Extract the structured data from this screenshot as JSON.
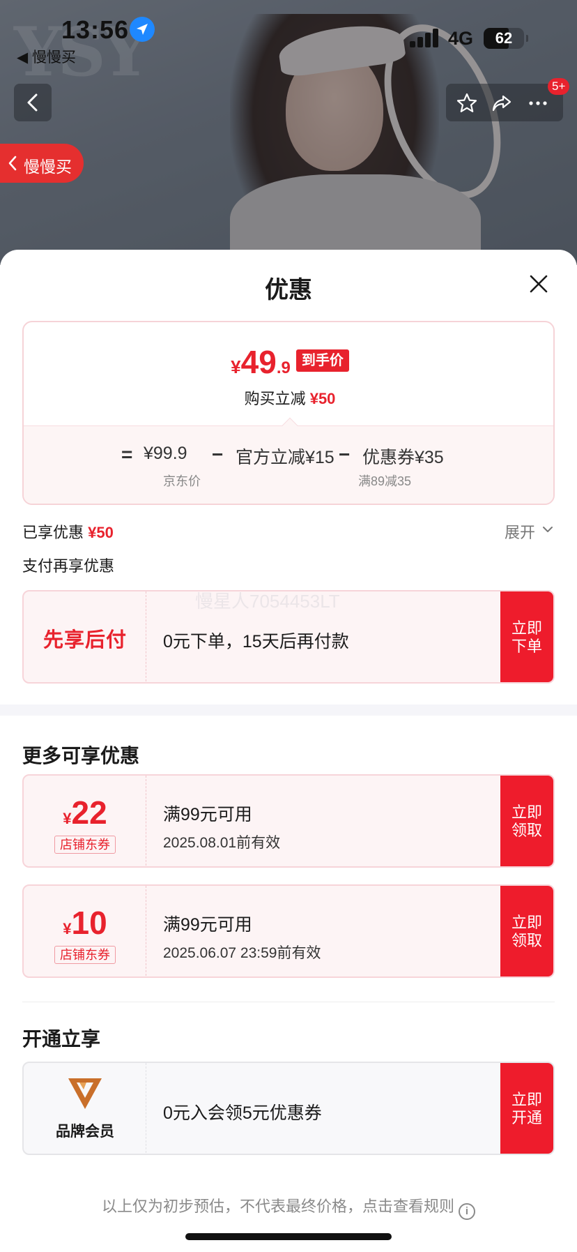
{
  "status_bar": {
    "time": "13:56",
    "back_app": "◀ 慢慢买",
    "network": "4G",
    "battery": "62",
    "battery_level": 0.62
  },
  "hero": {
    "watermark_logo": "YSY",
    "slow_pill_label": "慢慢买",
    "notification_badge": "5+"
  },
  "sheet": {
    "title": "优惠",
    "price_card": {
      "currency": "¥",
      "price_int": "49",
      "price_dec": ".9",
      "price_tag": "到手价",
      "instant_reduction_label": "购买立减",
      "instant_reduction_value": "¥50",
      "formula": {
        "equals": "=",
        "base_price": "¥99.9",
        "minus1": "−",
        "official_discount": "官方立减¥15",
        "minus2": "−",
        "coupon_discount": "优惠券¥35",
        "base_price_caption": "京东价",
        "coupon_caption": "满89减35"
      }
    },
    "enjoyed_label": "已享优惠",
    "enjoyed_value": "¥50",
    "expand_label": "展开",
    "pay_section_title": "支付再享优惠",
    "pay_later": {
      "left_label": "先享后付",
      "description": "0元下单，15天后再付款",
      "cta_line1": "立即",
      "cta_line2": "下单"
    },
    "watermark_text": "慢星人7054453LT",
    "more_section_title": "更多可享优惠",
    "coupons": [
      {
        "currency": "¥",
        "amount": "22",
        "type_tag": "店铺东券",
        "condition": "满99元可用",
        "expiry": "2025.08.01前有效",
        "cta_line1": "立即",
        "cta_line2": "领取"
      },
      {
        "currency": "¥",
        "amount": "10",
        "type_tag": "店铺东券",
        "condition": "满99元可用",
        "expiry": "2025.06.07 23:59前有效",
        "cta_line1": "立即",
        "cta_line2": "领取"
      }
    ],
    "membership_section_title": "开通立享",
    "membership": {
      "left_label": "品牌会员",
      "description": "0元入会领5元优惠券",
      "cta_line1": "立即",
      "cta_line2": "开通"
    },
    "footnote": "以上仅为初步预估，不代表最终价格，点击查看规则",
    "footnote_icon": "i"
  },
  "colors": {
    "accent_red": "#e8222d",
    "cta_red": "#ee1c2c",
    "brand_logo": "#c96f2a"
  },
  "icons": [
    "location-arrow-icon",
    "back-chevron-icon",
    "star-icon",
    "share-icon",
    "more-icon",
    "close-icon",
    "chevron-down-icon",
    "info-icon",
    "brand-v-icon"
  ]
}
